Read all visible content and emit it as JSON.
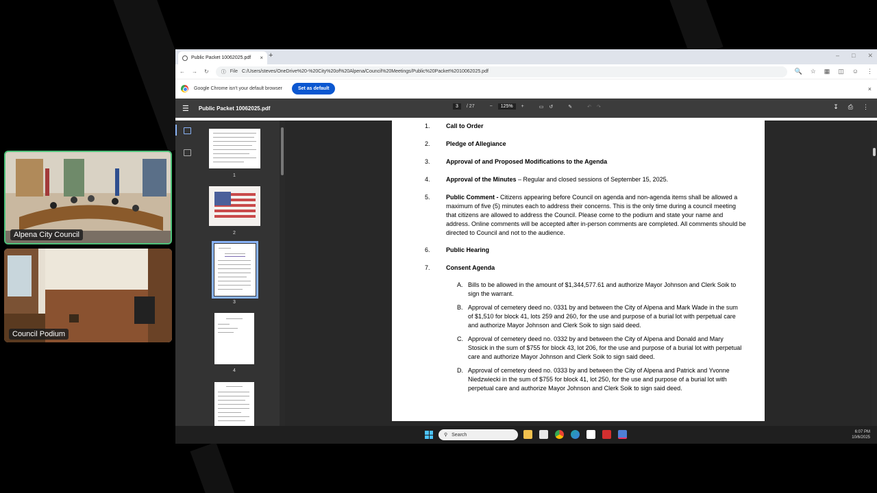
{
  "camera_feeds": [
    {
      "label": "Alpena City Council"
    },
    {
      "label": "Council Podium"
    }
  ],
  "browser": {
    "tab_title": "Public Packet 10062025.pdf",
    "tab_close": "×",
    "new_tab": "+",
    "address_prefix": "File",
    "address_url": "C:/Users/steves/OneDrive%20-%20City%20of%20Alpena/Council%20Meetings/Public%20Packet%2010062025.pdf",
    "info_text": "Google Chrome isn't your default browser",
    "info_button": "Set as default",
    "info_close": "×"
  },
  "pdf": {
    "title": "Public Packet 10062025.pdf",
    "current_page": "3",
    "total_pages": "/ 27",
    "zoom": "125%",
    "thumbnails": [
      "1",
      "2",
      "3",
      "4"
    ]
  },
  "agenda": {
    "items": [
      {
        "num": "1.",
        "title": "Call to Order",
        "text": ""
      },
      {
        "num": "2.",
        "title": "Pledge of Allegiance",
        "text": ""
      },
      {
        "num": "3.",
        "title": "Approval of and Proposed Modifications to the Agenda",
        "text": ""
      },
      {
        "num": "4.",
        "title": "Approval of the Minutes",
        "text": " – Regular and closed sessions of September 15, 2025."
      },
      {
        "num": "5.",
        "title": "Public Comment - ",
        "text": "Citizens appearing before Council on agenda and non-agenda items shall be allowed a maximum of five (5) minutes each to address their concerns. This is the only time during a council meeting that citizens are allowed to address the Council.  Please come to the podium and state your name and address.  Online comments will be accepted after in-person comments are completed.  All comments should be directed to Council and not to the audience."
      },
      {
        "num": "6.",
        "title": "Public Hearing",
        "text": ""
      },
      {
        "num": "7.",
        "title": "Consent Agenda",
        "text": ""
      }
    ],
    "consent": [
      {
        "letter": "A.",
        "text": "Bills to be allowed in the amount of $1,344,577.61 and authorize Mayor Johnson and Clerk Soik to sign the warrant."
      },
      {
        "letter": "B.",
        "text": "Approval of cemetery deed no. 0331 by and between the City of Alpena and Mark Wade in the sum of $1,510 for block 41, lots 259 and 260, for the use and purpose of a burial lot with perpetual care and authorize Mayor Johnson and Clerk Soik to sign said deed."
      },
      {
        "letter": "C.",
        "text": "Approval of cemetery deed no. 0332 by and between the City of Alpena and Donald and Mary Stosick in the sum of $755 for block 43, lot 206, for the use and purpose of a burial lot with perpetual care and authorize Mayor Johnson and Clerk Soik to sign said deed."
      },
      {
        "letter": "D.",
        "text": "Approval of cemetery deed no. 0333 by and between the City of Alpena and Patrick and Yvonne Niedzwiecki in the sum of $755 for block 41, lot 250, for the use and purpose of a burial lot with perpetual care and authorize Mayor Johnson and Clerk Soik to sign said deed."
      }
    ]
  },
  "taskbar": {
    "search_placeholder": "Search",
    "time": "6:07 PM",
    "date": "10/6/2025"
  },
  "colors": {
    "feed_active_border": "#4ec27a",
    "chrome_blue": "#0b57d0",
    "pdf_toolbar": "#3c3c3c"
  }
}
